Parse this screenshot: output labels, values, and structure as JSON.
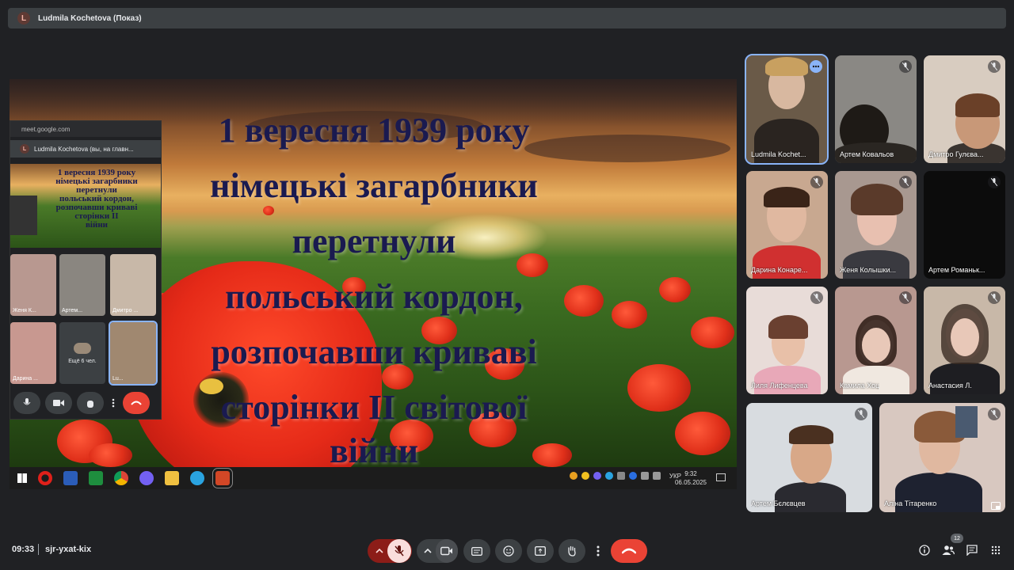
{
  "presenter_bar": {
    "avatar_letter": "L",
    "title": "Ludmila Kochetova (Показ)"
  },
  "slide": {
    "lines": [
      "1 вересня 1939 року",
      "німецькі загарбники",
      "перетнули",
      "польський кордон,",
      "розпочавши криваві",
      "сторінки ІІ світової",
      "війни"
    ]
  },
  "taskbar": {
    "language": "УКР",
    "time": "9:32",
    "date": "06.05.2025"
  },
  "mini_window": {
    "url": "meet.google.com",
    "avatar_letter": "L",
    "presenter_label": "Ludmila Kochetova (вы, на главн...",
    "slide_lines": [
      "1 вересня 1939 року",
      "німецькі загарбники",
      "перетнули",
      "польський кордон,",
      "розпочавши криваві",
      "сторінки ІІ",
      "війни"
    ],
    "tiles": [
      "Женя К...",
      "Артем...",
      "Дмитро ...",
      "Дарина ...",
      "Lu..."
    ],
    "more_label": "Ещё 6 чел."
  },
  "participants": [
    {
      "name": "Ludmila Kochet..."
    },
    {
      "name": "Артем Ковальов"
    },
    {
      "name": "Дмитро Гулєва..."
    },
    {
      "name": "Дарина Конаре..."
    },
    {
      "name": "Женя Колышки..."
    },
    {
      "name": "Артем Романьк..."
    },
    {
      "name": "Лиля Лифенцева"
    },
    {
      "name": "Камила Хоц"
    },
    {
      "name": "Анастасия Л."
    },
    {
      "name": "Артем Бєлєвцев"
    },
    {
      "name": "Аліна Тітаренко"
    }
  ],
  "bottom_bar": {
    "clock": "09:33",
    "meeting_code": "sjr-yxat-kix",
    "participant_count": "12"
  },
  "colors": {
    "accent": "#8ab4f8",
    "end_call": "#ea4335",
    "background": "#202124",
    "tile": "#3c4043"
  }
}
